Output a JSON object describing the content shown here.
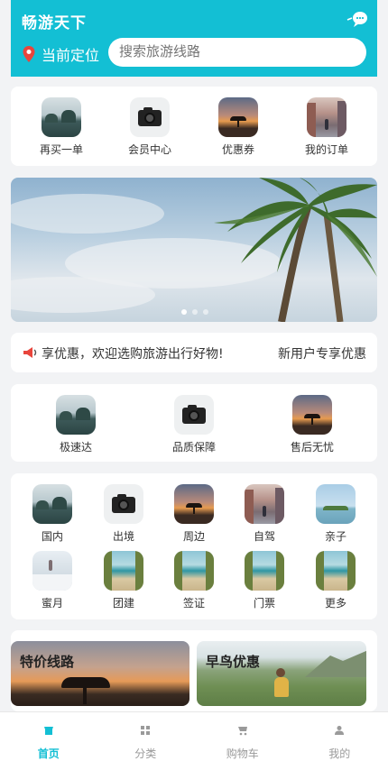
{
  "header": {
    "title": "畅游天下",
    "location_label": "当前定位",
    "search_placeholder": "搜索旅游线路"
  },
  "quick_actions": [
    {
      "label": "再买一单",
      "icon": "lake-photo"
    },
    {
      "label": "会员中心",
      "icon": "camera-photo"
    },
    {
      "label": "优惠券",
      "icon": "sunset-tree-photo"
    },
    {
      "label": "我的订单",
      "icon": "city-street-photo"
    }
  ],
  "banner": {
    "slides": 3,
    "active_slide": 1
  },
  "notice": {
    "text": "享优惠，欢迎选购旅游出行好物!",
    "right_text": "新用户专享优惠"
  },
  "services": [
    {
      "label": "极速达",
      "icon": "lake-photo"
    },
    {
      "label": "品质保障",
      "icon": "camera-photo"
    },
    {
      "label": "售后无忧",
      "icon": "sunset-tree-photo"
    }
  ],
  "categories": [
    {
      "label": "国内",
      "icon": "lake-photo"
    },
    {
      "label": "出境",
      "icon": "camera-photo"
    },
    {
      "label": "周边",
      "icon": "sunset-tree-photo"
    },
    {
      "label": "自驾",
      "icon": "city-street-photo"
    },
    {
      "label": "亲子",
      "icon": "island-photo"
    },
    {
      "label": "蜜月",
      "icon": "snow-beach-photo"
    },
    {
      "label": "团建",
      "icon": "beach-path-photo"
    },
    {
      "label": "签证",
      "icon": "beach-path-photo"
    },
    {
      "label": "门票",
      "icon": "beach-path-photo"
    },
    {
      "label": "更多",
      "icon": "beach-path-photo"
    }
  ],
  "promos": [
    {
      "label": "特价线路"
    },
    {
      "label": "早鸟优惠"
    }
  ],
  "tabs": [
    {
      "label": "首页",
      "icon": "home-icon"
    },
    {
      "label": "分类",
      "icon": "category-grid-icon"
    },
    {
      "label": "购物车",
      "icon": "cart-icon"
    },
    {
      "label": "我的",
      "icon": "user-icon"
    }
  ],
  "colors": {
    "accent": "#13bfd4",
    "background": "#f2f3f5"
  }
}
